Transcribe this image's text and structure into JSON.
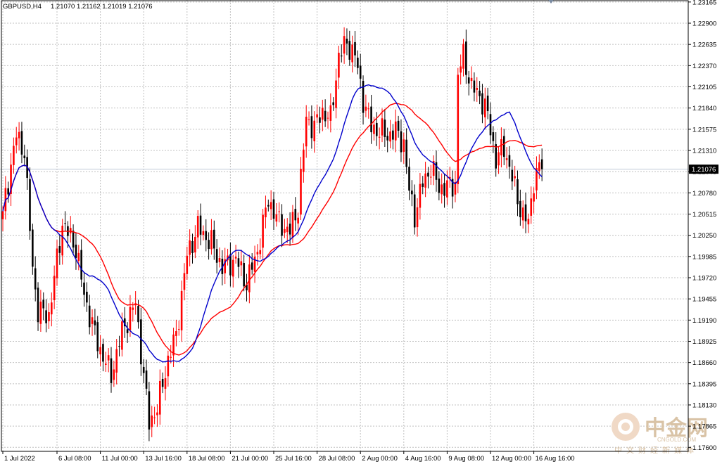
{
  "header": {
    "symbol": "GBPUSD,H4",
    "ohlc": "1.21070 1.21162 1.21019 1.21076"
  },
  "current_price_label": "1.21076",
  "watermark": {
    "brand_cn": "中金网",
    "brand_en": "CNGOLD.COM",
    "sub_cn": "中文财经新媒体"
  },
  "colors": {
    "background": "#ffffff",
    "grid": "#c0c0c0",
    "bull": "#ff0000",
    "bear": "#000000",
    "ma_fast": "#0000cc",
    "ma_slow": "#ff0000",
    "current_line": "#c0c8d8",
    "price_tag_bg": "#000000",
    "price_tag_fg": "#ffffff"
  },
  "chart_data": {
    "type": "candlestick",
    "symbol": "GBPUSD",
    "timeframe": "H4",
    "grid": true,
    "ylim": [
      1.1755,
      1.2319
    ],
    "y_ticks": [
      "1.23165",
      "1.22900",
      "1.22635",
      "1.22370",
      "1.22105",
      "1.21840",
      "1.21575",
      "1.21310",
      "1.21045",
      "1.20780",
      "1.20515",
      "1.20250",
      "1.19985",
      "1.19720",
      "1.19455",
      "1.19190",
      "1.18925",
      "1.18660",
      "1.18395",
      "1.18130",
      "1.17865",
      "1.17600"
    ],
    "x_ticks": [
      {
        "label": "1 Jul 2022",
        "index": 0
      },
      {
        "label": "6 Jul 08:00",
        "index": 20
      },
      {
        "label": "11 Jul 00:00",
        "index": 36
      },
      {
        "label": "13 Jul 16:00",
        "index": 52
      },
      {
        "label": "18 Jul 08:00",
        "index": 68
      },
      {
        "label": "21 Jul 00:00",
        "index": 84
      },
      {
        "label": "25 Jul 16:00",
        "index": 100
      },
      {
        "label": "28 Jul 08:00",
        "index": 116
      },
      {
        "label": "2 Aug 00:00",
        "index": 132
      },
      {
        "label": "4 Aug 16:00",
        "index": 148
      },
      {
        "label": "9 Aug 08:00",
        "index": 164
      },
      {
        "label": "12 Aug 00:00",
        "index": 180
      },
      {
        "label": "16 Aug 16:00",
        "index": 196
      }
    ],
    "current_price": 1.21076,
    "moving_averages": [
      {
        "period": 20,
        "color": "#0000cc"
      },
      {
        "period": 34,
        "color": "#ff0000"
      }
    ],
    "waypoints": [
      [
        0,
        1.2055
      ],
      [
        5,
        1.215
      ],
      [
        8,
        1.213
      ],
      [
        11,
        1.1985
      ],
      [
        13,
        1.193
      ],
      [
        17,
        1.1925
      ],
      [
        22,
        1.204
      ],
      [
        27,
        1.201
      ],
      [
        30,
        1.195
      ],
      [
        35,
        1.189
      ],
      [
        40,
        1.185
      ],
      [
        44,
        1.1905
      ],
      [
        49,
        1.194
      ],
      [
        54,
        1.179
      ],
      [
        57,
        1.181
      ],
      [
        61,
        1.187
      ],
      [
        64,
        1.19
      ],
      [
        68,
        1.2
      ],
      [
        72,
        1.2035
      ],
      [
        77,
        1.2015
      ],
      [
        81,
        1.1985
      ],
      [
        86,
        1.1995
      ],
      [
        90,
        1.1965
      ],
      [
        94,
        1.2005
      ],
      [
        98,
        1.207
      ],
      [
        102,
        1.204
      ],
      [
        106,
        1.203
      ],
      [
        109,
        1.206
      ],
      [
        112,
        1.217
      ],
      [
        115,
        1.216
      ],
      [
        118,
        1.218
      ],
      [
        121,
        1.217
      ],
      [
        124,
        1.225
      ],
      [
        127,
        1.2265
      ],
      [
        130,
        1.225
      ],
      [
        133,
        1.2195
      ],
      [
        136,
        1.216
      ],
      [
        139,
        1.2155
      ],
      [
        142,
        1.215
      ],
      [
        145,
        1.2155
      ],
      [
        148,
        1.214
      ],
      [
        150,
        1.208
      ],
      [
        152,
        1.205
      ],
      [
        155,
        1.209
      ],
      [
        158,
        1.211
      ],
      [
        161,
        1.2085
      ],
      [
        164,
        1.2085
      ],
      [
        167,
        1.209
      ],
      [
        168,
        1.2225
      ],
      [
        170,
        1.225
      ],
      [
        173,
        1.221
      ],
      [
        176,
        1.22
      ],
      [
        179,
        1.2175
      ],
      [
        182,
        1.212
      ],
      [
        185,
        1.2135
      ],
      [
        187,
        1.211
      ],
      [
        190,
        1.207
      ],
      [
        192,
        1.205
      ],
      [
        194,
        1.204
      ],
      [
        196,
        1.2095
      ],
      [
        198,
        1.2108
      ]
    ]
  }
}
